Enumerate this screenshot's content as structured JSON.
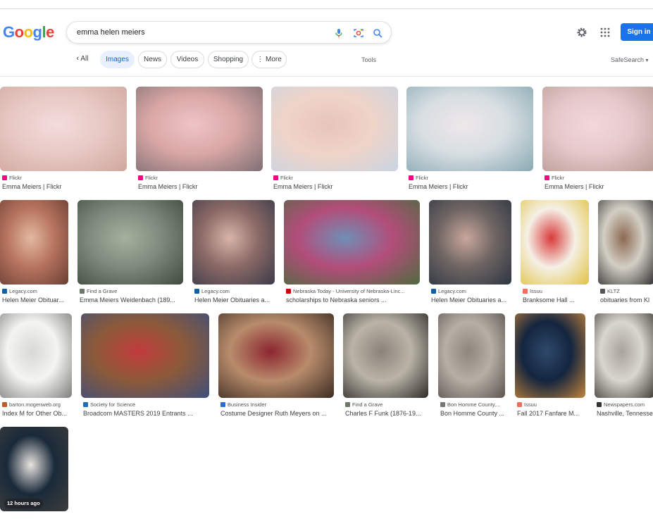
{
  "logo": {
    "letters": [
      "G",
      "o",
      "o",
      "g",
      "l",
      "e"
    ]
  },
  "search": {
    "query": "emma helen meiers"
  },
  "header": {
    "signin_label": "Sign in"
  },
  "tabs": [
    {
      "label": "All",
      "state": "plain"
    },
    {
      "label": "Images",
      "state": "active"
    },
    {
      "label": "News",
      "state": "normal"
    },
    {
      "label": "Videos",
      "state": "normal"
    },
    {
      "label": "Shopping",
      "state": "normal"
    },
    {
      "label": "More",
      "state": "normal"
    }
  ],
  "tools_label": "Tools",
  "safesearch_label": "SafeSearch",
  "results": [
    {
      "source": "Flickr",
      "title": "Emma Meiers | Flickr",
      "fav_color": "#ff0084",
      "thumb": [
        "#e8c9c4",
        "#f3dcdc",
        "#cfa89e"
      ]
    },
    {
      "source": "Flickr",
      "title": "Emma Meiers | Flickr",
      "fav_color": "#ff0084",
      "thumb": [
        "#d9a7a5",
        "#efc4c8",
        "#7f6f74"
      ]
    },
    {
      "source": "Flickr",
      "title": "Emma Meiers | Flickr",
      "fav_color": "#ff0084",
      "thumb": [
        "#f0d4c8",
        "#e7c4bc",
        "#c9d4e2"
      ]
    },
    {
      "source": "Flickr",
      "title": "Emma Meiers | Flickr",
      "fav_color": "#ff0084",
      "thumb": [
        "#d7dee2",
        "#efe7ea",
        "#8aa9b3"
      ]
    },
    {
      "source": "Flickr",
      "title": "Emma Meiers | Flickr",
      "fav_color": "#ff0084",
      "thumb": [
        "#e6c8cb",
        "#f2d8da",
        "#b99b95"
      ]
    },
    {
      "source": "Legacy.com",
      "title": "Helen Meier Obituar...",
      "fav_color": "#0f5fa8",
      "thumb": [
        "#b7745f",
        "#e3b9a0",
        "#6b3e33"
      ]
    },
    {
      "source": "Find a Grave",
      "title": "Emma Meiers Weidenbach (189...",
      "fav_color": "#6a7a6a",
      "thumb": [
        "#7d8a7c",
        "#a6b09e",
        "#3f4b3d"
      ]
    },
    {
      "source": "Legacy.com",
      "title": "Helen Meier Obituaries a...",
      "fav_color": "#0f5fa8",
      "thumb": [
        "#8c6a66",
        "#d8b4a9",
        "#3b3b4a"
      ]
    },
    {
      "source": "Nebraska Today - University of Nebraska-Linc...",
      "title": "scholarships to Nebraska seniors ...",
      "fav_color": "#d00000",
      "thumb": [
        "#b34d7a",
        "#6f8fb6",
        "#4e6b3f"
      ]
    },
    {
      "source": "Legacy.com",
      "title": "Helen Meier Obituaries a...",
      "fav_color": "#0f5fa8",
      "thumb": [
        "#6f6563",
        "#c9a79c",
        "#2d3542"
      ]
    },
    {
      "source": "Issuu",
      "title": "Branksome Hall ...",
      "fav_color": "#f36d5d",
      "thumb": [
        "#f5f0e6",
        "#d93a3a",
        "#e1c240"
      ]
    },
    {
      "source": "KLTZ",
      "title": "obituaries from Kl",
      "fav_color": "#555555",
      "thumb": [
        "#d3cfc5",
        "#8b6a52",
        "#2f2f2f"
      ]
    },
    {
      "source": "barton.mogenweb.org",
      "title": "Index M for Other Ob...",
      "fav_color": "#c05b2a",
      "thumb": [
        "#f4f4f2",
        "#d8d8d6",
        "#7e7e7c"
      ]
    },
    {
      "source": "Society for Science",
      "title": "Broadcom MASTERS 2019 Entrants ...",
      "fav_color": "#1c6fb5",
      "thumb": [
        "#8c5a3a",
        "#c23b3b",
        "#3e4f7a"
      ]
    },
    {
      "source": "Business Insider",
      "title": "Costume Designer Ruth Meyers on ...",
      "fav_color": "#2c6cd6",
      "thumb": [
        "#b88c6b",
        "#8c2530",
        "#3b2b22"
      ]
    },
    {
      "source": "Find a Grave",
      "title": "Charles F Funk (1876-19...",
      "fav_color": "#6a7a6a",
      "thumb": [
        "#bab4a8",
        "#8a837a",
        "#2f2b27"
      ]
    },
    {
      "source": "Bon Homme County,...",
      "title": "Bon Homme County ...",
      "fav_color": "#777777",
      "thumb": [
        "#b6afa6",
        "#8d867d",
        "#5b544d"
      ]
    },
    {
      "source": "Issuu",
      "title": "Fall 2017 Fanfare M...",
      "fav_color": "#f36d5d",
      "thumb": [
        "#14253f",
        "#2f4a6b",
        "#c3843b"
      ]
    },
    {
      "source": "Newspapers.com",
      "title": "Nashville, Tennesse",
      "fav_color": "#333333",
      "thumb": [
        "#d9d6cf",
        "#a8a49c",
        "#3e3a34"
      ]
    },
    {
      "source": "",
      "title": "",
      "fav_color": "#ff0084",
      "thumb": [
        "#1a2a3a",
        "#e8e4e0",
        "#3d3d3d"
      ],
      "badge": "12 hours ago"
    }
  ]
}
